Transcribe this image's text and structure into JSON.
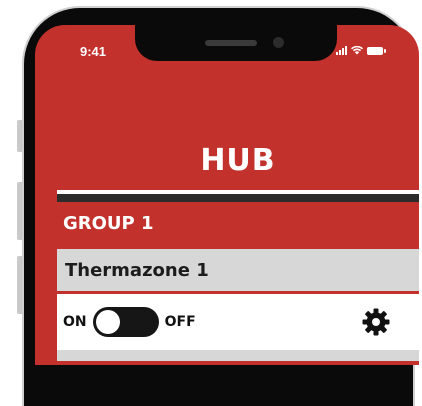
{
  "status_bar": {
    "time": "9:41",
    "icons": [
      "signal-icon",
      "wifi-icon",
      "battery-icon"
    ]
  },
  "header": {
    "title": "HUB",
    "background": "#c2312c"
  },
  "group": {
    "label": "GROUP 1"
  },
  "zone": {
    "name": "Thermazone 1"
  },
  "controls": {
    "on_label": "ON",
    "off_label": "OFF",
    "toggle_state": "on",
    "settings_icon": "gear-icon"
  },
  "colors": {
    "accent": "#c2312c",
    "zone_bg": "#d7d7d7",
    "toggle_bg": "#161616"
  }
}
